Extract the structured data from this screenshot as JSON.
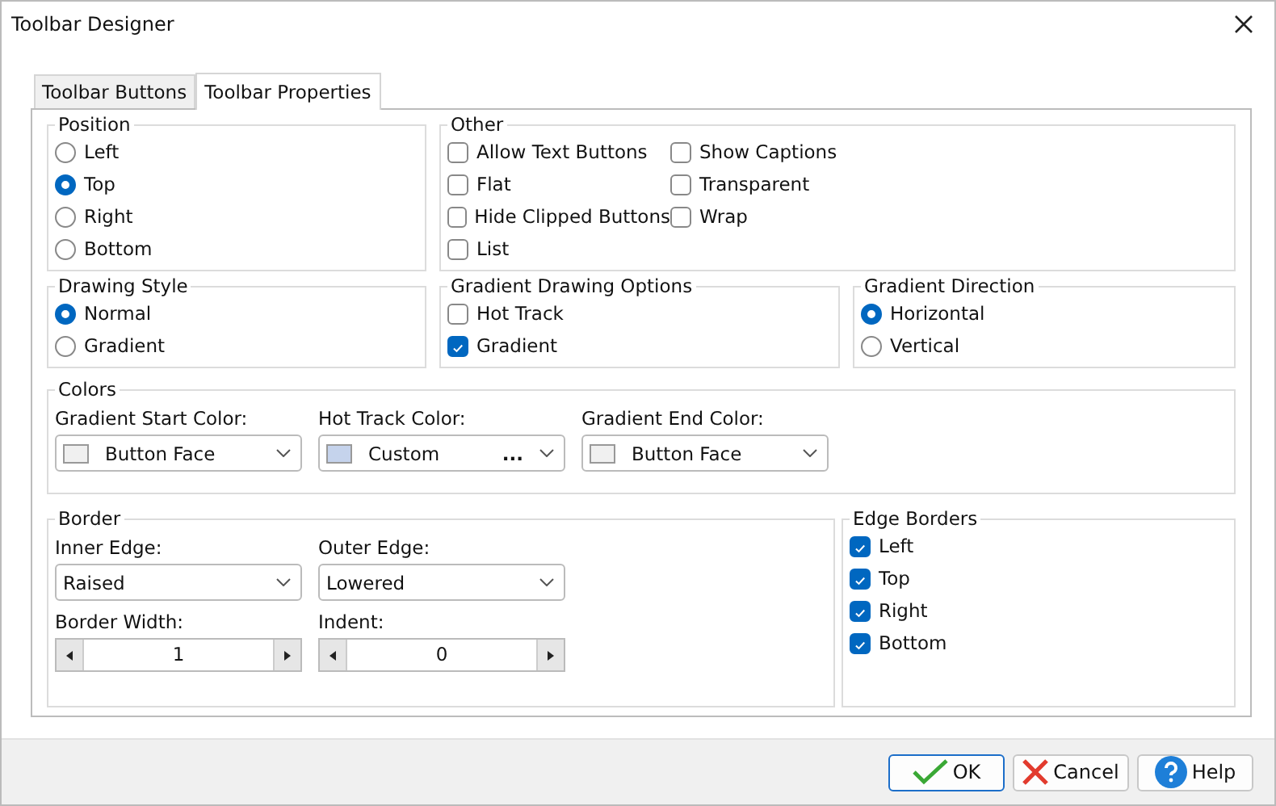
{
  "window": {
    "title": "Toolbar Designer"
  },
  "tabs": [
    {
      "label": "Toolbar Buttons",
      "selected": false
    },
    {
      "label": "Toolbar Properties",
      "selected": true
    }
  ],
  "position": {
    "title": "Position",
    "options": [
      {
        "label": "Left",
        "selected": false
      },
      {
        "label": "Top",
        "selected": true
      },
      {
        "label": "Right",
        "selected": false
      },
      {
        "label": "Bottom",
        "selected": false
      }
    ]
  },
  "other": {
    "title": "Other",
    "items": [
      {
        "label": "Allow Text Buttons",
        "checked": false
      },
      {
        "label": "Flat",
        "checked": false
      },
      {
        "label": "Hide Clipped Buttons",
        "checked": false
      },
      {
        "label": "List",
        "checked": false
      },
      {
        "label": "Show Captions",
        "checked": false
      },
      {
        "label": "Transparent",
        "checked": false
      },
      {
        "label": "Wrap",
        "checked": false
      }
    ]
  },
  "drawing_style": {
    "title": "Drawing Style",
    "options": [
      {
        "label": "Normal",
        "selected": true
      },
      {
        "label": "Gradient",
        "selected": false
      }
    ]
  },
  "gradient_drawing_options": {
    "title": "Gradient Drawing Options",
    "items": [
      {
        "label": "Hot Track",
        "checked": false
      },
      {
        "label": "Gradient",
        "checked": true
      }
    ]
  },
  "gradient_direction": {
    "title": "Gradient Direction",
    "options": [
      {
        "label": "Horizontal",
        "selected": true
      },
      {
        "label": "Vertical",
        "selected": false
      }
    ]
  },
  "colors": {
    "title": "Colors",
    "pickers": [
      {
        "label": "Gradient Start Color:",
        "value": "Button Face",
        "color": "#f0f0f0"
      },
      {
        "label": "Hot Track Color:",
        "value": "Custom",
        "color": "#c5d3ec",
        "more": "..."
      },
      {
        "label": "Gradient End Color:",
        "value": "Button Face",
        "color": "#f0f0f0"
      }
    ]
  },
  "border": {
    "title": "Border",
    "dropdowns": [
      {
        "label": "Inner Edge:",
        "value": "Raised"
      },
      {
        "label": "Outer Edge:",
        "value": "Lowered"
      }
    ],
    "spinners": [
      {
        "label": "Border Width:",
        "value": "1"
      },
      {
        "label": "Indent:",
        "value": "0"
      }
    ]
  },
  "edge_borders": {
    "title": "Edge Borders",
    "items": [
      {
        "label": "Left",
        "checked": true
      },
      {
        "label": "Top",
        "checked": true
      },
      {
        "label": "Right",
        "checked": true
      },
      {
        "label": "Bottom",
        "checked": true
      }
    ]
  },
  "buttons": [
    {
      "label": "OK",
      "kind": "ok"
    },
    {
      "label": "Cancel",
      "kind": "cancel"
    },
    {
      "label": "Help",
      "kind": "help"
    }
  ]
}
